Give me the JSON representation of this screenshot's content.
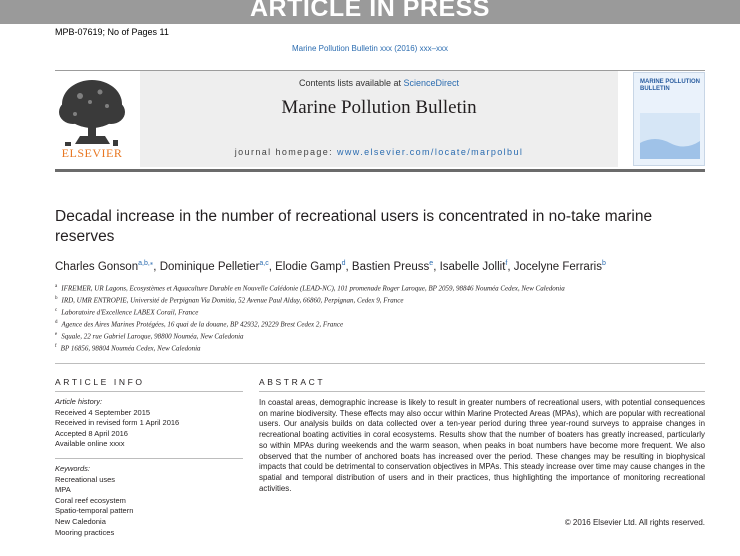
{
  "banner": "ARTICLE IN PRESS",
  "manuscript_info": "MPB-07619; No of Pages 11",
  "citation": "Marine Pollution Bulletin xxx (2016) xxx–xxx",
  "header": {
    "contents_prefix": "Contents lists available at ",
    "contents_link": "ScienceDirect",
    "journal": "Marine Pollution Bulletin",
    "homepage_prefix": "journal homepage: ",
    "homepage_url": "www.elsevier.com/locate/marpolbul",
    "publisher": "ELSEVIER",
    "cover_title": "MARINE POLLUTION BULLETIN"
  },
  "article": {
    "title": "Decadal increase in the number of recreational users is concentrated in no-take marine reserves",
    "authors": [
      {
        "name": "Charles Gonson",
        "sup": "a,b,⁎",
        "sep": ", "
      },
      {
        "name": "Dominique Pelletier",
        "sup": "a,c",
        "sep": ", "
      },
      {
        "name": "Elodie Gamp",
        "sup": "d",
        "sep": ", "
      },
      {
        "name": "Bastien Preuss",
        "sup": "e",
        "sep": ", "
      },
      {
        "name": "Isabelle Jollit",
        "sup": "f",
        "sep": ", "
      },
      {
        "name": "Jocelyne Ferraris",
        "sup": "b",
        "sep": ""
      }
    ],
    "affiliations": [
      {
        "mark": "a",
        "text": "IFREMER, UR Lagons, Ecosystèmes et Aquaculture Durable en Nouvelle Calédonie (LEAD-NC), 101 promenade Roger Laroque, BP 2059, 98846 Nouméa Cedex, New Caledonia"
      },
      {
        "mark": "b",
        "text": "IRD, UMR ENTROPIE, Université de Perpignan Via Domitia, 52 Avenue Paul Alduy, 66860, Perpignan, Cedex 9, France"
      },
      {
        "mark": "c",
        "text": "Laboratoire d'Excellence LABEX Corail, France"
      },
      {
        "mark": "d",
        "text": "Agence des Aires Marines Protégées, 16 quai de la douane, BP 42932, 29229 Brest Cedex 2, France"
      },
      {
        "mark": "e",
        "text": "Squale, 22 rue Gabriel Laroque, 98800 Nouméa, New Caledonia"
      },
      {
        "mark": "f",
        "text": "BP 16856, 98804 Nouméa Cedex, New Caledonia"
      }
    ]
  },
  "article_info": {
    "heading": "ARTICLE INFO",
    "history_label": "Article history:",
    "history": [
      "Received 4 September 2015",
      "Received in revised form 1 April 2016",
      "Accepted 8 April 2016",
      "Available online xxxx"
    ],
    "keywords_label": "Keywords:",
    "keywords": [
      "Recreational uses",
      "MPA",
      "Coral reef ecosystem",
      "Spatio-temporal pattern",
      "New Caledonia",
      "Mooring practices"
    ]
  },
  "abstract": {
    "heading": "ABSTRACT",
    "text": "In coastal areas, demographic increase is likely to result in greater numbers of recreational users, with potential consequences on marine biodiversity. These effects may also occur within Marine Protected Areas (MPAs), which are popular with recreational users. Our analysis builds on data collected over a ten-year period during three year-round surveys to appraise changes in recreational boating activities in coral ecosystems. Results show that the number of boaters has greatly increased, particularly so within MPAs during weekends and the warm season, when peaks in boat numbers have become more frequent. We also observed that the number of anchored boats has increased over the period. These changes may be resulting in biophysical impacts that could be detrimental to conservation objectives in MPAs. This steady increase over time may cause changes in the spatial and temporal distribution of users and in their practices, thus highlighting the importance of monitoring recreational activities.",
    "copyright": "© 2016 Elsevier Ltd. All rights reserved."
  },
  "colors": {
    "link": "#2b6cb0",
    "elsevier": "#e87722",
    "banner": "#9a9a9a"
  }
}
